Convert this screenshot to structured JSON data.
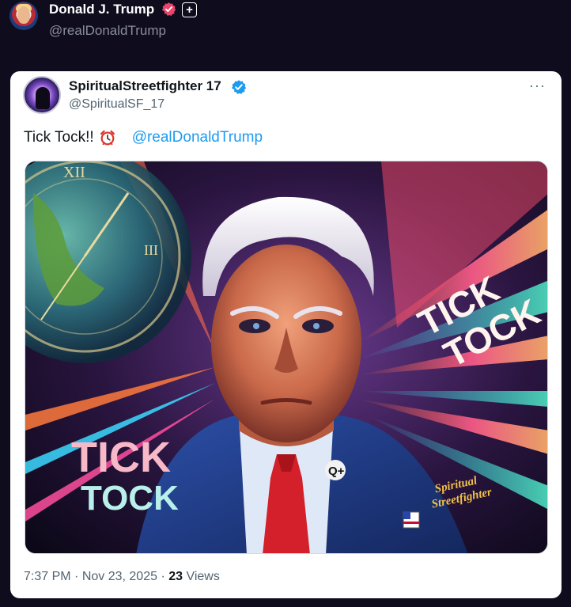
{
  "header": {
    "author_name": "Donald J. Trump",
    "author_handle": "@realDonaldTrump",
    "verified_icon": "verified-badge-icon",
    "plus_label": "+"
  },
  "quoted_post": {
    "author_name": "SpiritualStreetfighter 17",
    "author_handle": "@SpiritualSF_17",
    "more_label": "···",
    "text": "Tick Tock!!",
    "emoji_icon": "alarm-clock-icon",
    "mention": "@realDonaldTrump",
    "image": {
      "overlay_text_left_line1": "TICK",
      "overlay_text_left_line2": "TOCK",
      "overlay_text_right_line1": "TICK",
      "overlay_text_right_line2": "TOCK",
      "lapel_pin_text": "Q+",
      "signature_line1": "Spiritual",
      "signature_line2": "Streetfighter"
    },
    "time": "7:37 PM",
    "date": "Nov 23, 2025",
    "views_count": "23",
    "views_label": "Views",
    "separator": " · "
  },
  "colors": {
    "page_background": "#0f0c1e",
    "card_background": "#ffffff",
    "mention_blue": "#1d9bf0",
    "verified_blue": "#1d9bf0",
    "verified_pink": "#e8466a"
  }
}
